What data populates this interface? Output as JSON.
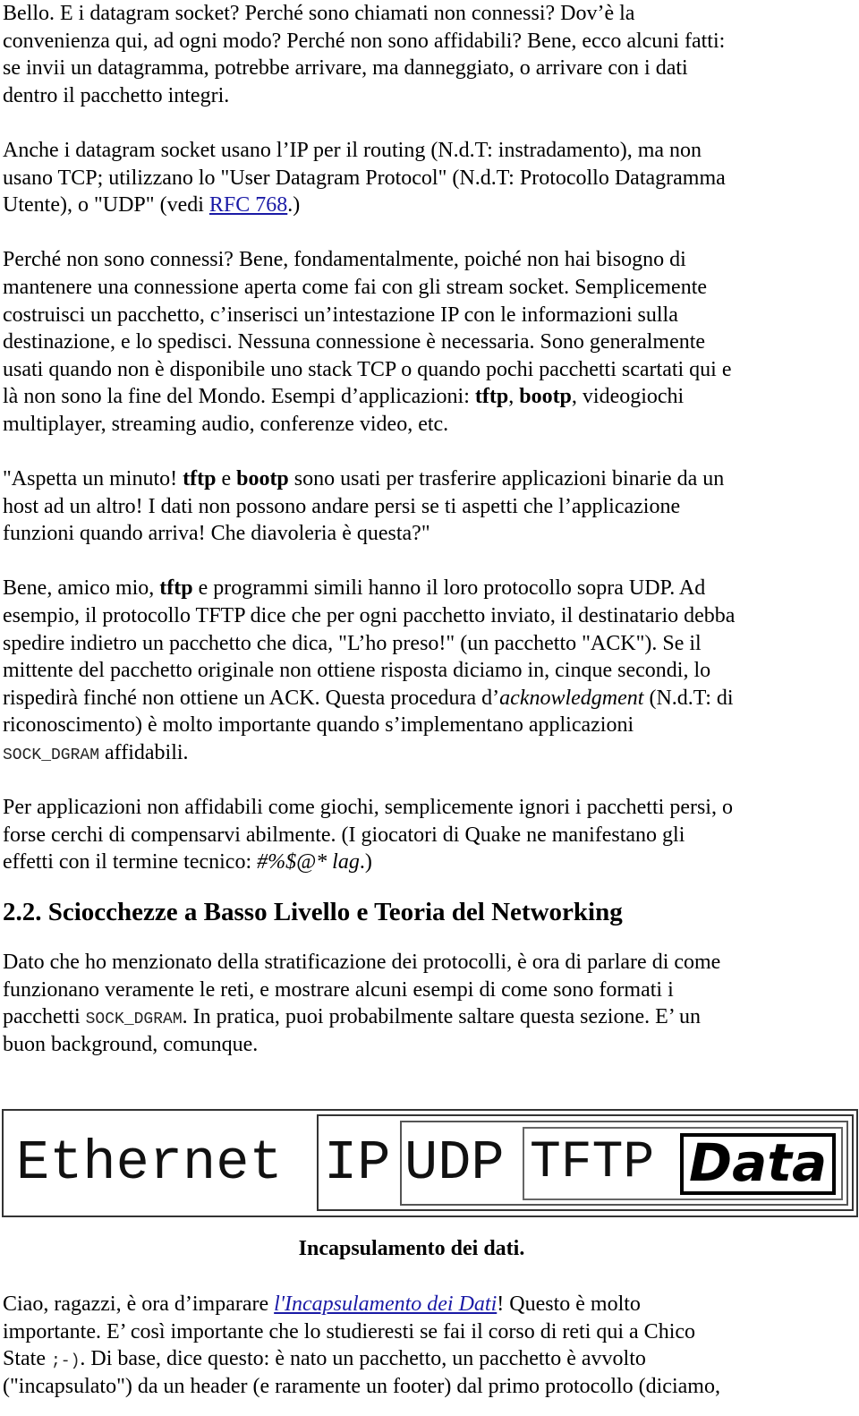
{
  "paragraphs": {
    "p1": [
      "Bello. E i datagram socket? Perché sono chiamati non connessi? Dov’è la",
      "convenienza qui, ad ogni modo? Perché non sono affidabili? Bene, ecco alcuni fatti:",
      "se invii un datagramma, potrebbe arrivare, ma danneggiato, o arrivare con i dati",
      "dentro il pacchetto integri."
    ],
    "p2": {
      "line1": "Anche i datagram socket usano l’IP per il routing (N.d.T: instradamento), ma non",
      "line2": "usano TCP;  utilizzano lo \"User Datagram Protocol\" (N.d.T: Protocollo Datagramma",
      "line3_before": "Utente), o \"UDP\" (vedi ",
      "line3_link": "RFC 768",
      "line3_after": ".)"
    },
    "p3": {
      "lines": [
        "Perché non sono connessi? Bene, fondamentalmente, poiché non hai bisogno di",
        "mantenere una connessione aperta come fai con gli stream socket. Semplicemente",
        "costruisci un pacchetto, c’inserisci un’intestazione IP con le informazioni sulla",
        "destinazione, e lo spedisci. Nessuna connessione è necessaria. Sono generalmente",
        "usati quando non è disponibile uno stack TCP o quando pochi pacchetti scartati qui e"
      ],
      "line6_before": "là non sono la fine del Mondo. Esempi d’applicazioni: ",
      "line6_bold1": "tftp",
      "line6_mid": ", ",
      "line6_bold2": "bootp",
      "line6_after": ", videogiochi",
      "line7": "multiplayer, streaming audio, conferenze video, etc."
    },
    "p4": {
      "line1_before": "\"Aspetta un minuto! ",
      "line1_bold1": "tftp",
      "line1_mid": " e ",
      "line1_bold2": "bootp",
      "line1_after": " sono usati per trasferire applicazioni binarie da un",
      "line2": "host ad un altro! I dati non possono andare persi se ti aspetti che l’applicazione",
      "line3": "funzioni quando arriva! Che diavoleria è questa?\""
    },
    "p5": {
      "line1_before": "Bene, amico mio, ",
      "line1_bold": "tftp",
      "line1_after": " e programmi simili hanno il loro protocollo sopra UDP. Ad",
      "lines": [
        "esempio, il protocollo TFTP dice che per ogni pacchetto inviato, il destinatario debba",
        "spedire indietro un pacchetto che dica, \"L’ho preso!\" (un pacchetto \"ACK\"). Se il",
        "mittente del pacchetto originale non ottiene risposta diciamo in, cinque secondi, lo"
      ],
      "line5_before": "rispedirà finché non ottiene un ACK. Questa procedura d’",
      "line5_italic": "acknowledgment",
      "line5_after": " (N.d.T: di",
      "line6": "riconoscimento) è molto importante quando s’implementano applicazioni",
      "line7_code": "SOCK_DGRAM",
      "line7_after": " affidabili."
    },
    "p6": {
      "line1": "Per applicazioni non affidabili come giochi, semplicemente ignori i pacchetti persi, o",
      "line2": "forse cerchi di compensarvi abilmente. (I giocatori di Quake ne manifestano gli",
      "line3_before": "effetti con il termine tecnico: ",
      "line3_italic": "#%$@* lag",
      "line3_after": ".)"
    },
    "p7": {
      "line1": "Dato che ho menzionato della stratificazione dei protocolli, è ora di parlare di come",
      "line2": "funzionano veramente le reti, e mostrare alcuni esempi di come sono formati i",
      "line3_before": "pacchetti ",
      "line3_code": "SOCK_DGRAM",
      "line3_after": ". In pratica, puoi probabilmente saltare questa sezione. E’ un",
      "line4": "buon background, comunque."
    },
    "p8": {
      "line1_before": "Ciao, ragazzi, è ora d’imparare ",
      "line1_link": "l'Incapsulamento dei Dati",
      "line1_after": "! Questo è molto",
      "line2": "importante. E’ così importante che lo studieresti se fai il corso di reti qui a Chico",
      "line3_before": "State ",
      "line3_code": ";-)",
      "line3_after": ". Di base, dice questo: è nato un pacchetto, un pacchetto è avvolto",
      "line4": "(\"incapsulato\") da un header (e raramente un footer) dal primo protocollo (diciamo,"
    }
  },
  "section_heading": "2.2. Sciocchezze a Basso Livello e Teoria del Networking",
  "diagram": {
    "layers": [
      "Ethernet",
      "IP",
      "UDP",
      "TFTP",
      "Data"
    ],
    "caption": "Incapsulamento dei dati."
  },
  "colors": {
    "link": "#1a1aa6",
    "text": "#000000",
    "background": "#ffffff"
  }
}
